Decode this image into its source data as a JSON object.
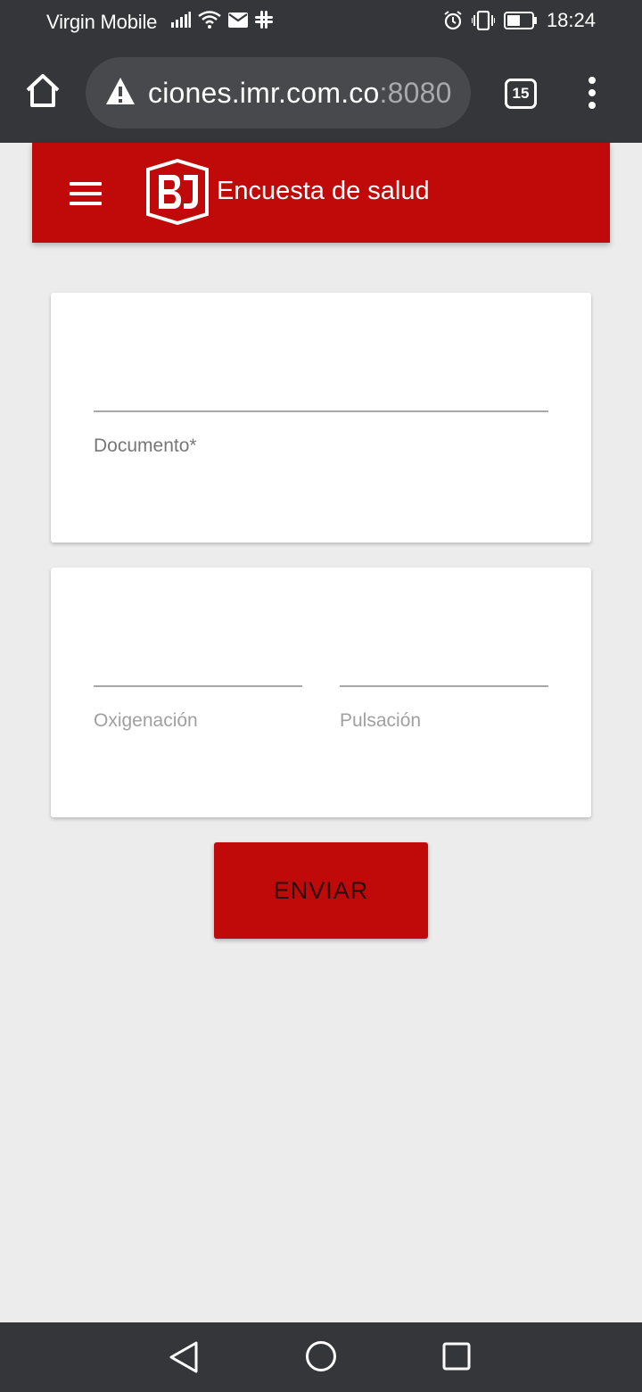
{
  "status_bar": {
    "carrier": "Virgin Mobile",
    "time": "18:24",
    "icons_left": [
      "signal-icon",
      "wifi-icon",
      "mail-icon",
      "slack-icon"
    ],
    "icons_right": [
      "alarm-icon",
      "vibrate-icon",
      "battery-icon"
    ]
  },
  "browser": {
    "url_main": "ciones.imr.com.co",
    "url_port": ":8080",
    "tab_count": "15",
    "icons": [
      "home-icon",
      "warning-icon",
      "tabs-icon",
      "more-vert-icon"
    ]
  },
  "app": {
    "title": "Encuesta de salud",
    "accent_color": "#c00a0a",
    "icons": [
      "menu-icon",
      "logo-icon"
    ]
  },
  "form": {
    "documento": {
      "label": "Documento*",
      "value": ""
    },
    "oxigenacion": {
      "label": "Oxigenación",
      "value": ""
    },
    "pulsacion": {
      "label": "Pulsación",
      "value": ""
    },
    "submit_label": "ENVIAR"
  },
  "nav_bar": {
    "icons": [
      "back-icon",
      "home-circle-icon",
      "recents-icon"
    ]
  }
}
